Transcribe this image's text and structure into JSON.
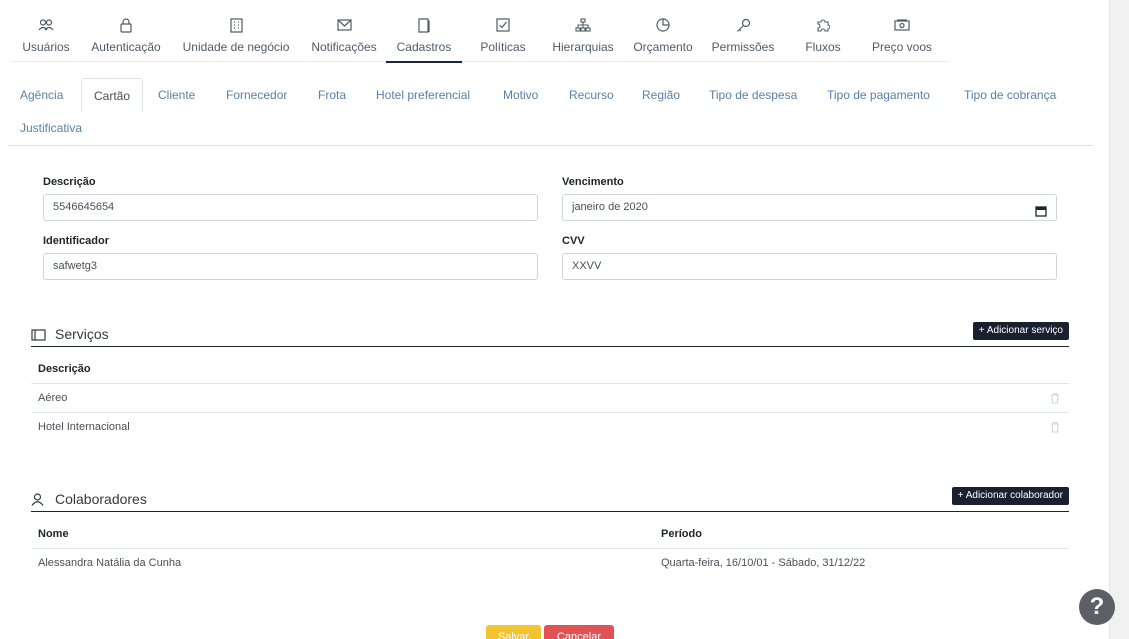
{
  "top_nav": {
    "items": [
      {
        "label": "Usuários",
        "icon": "users-icon"
      },
      {
        "label": "Autenticação",
        "icon": "lock-icon"
      },
      {
        "label": "Unidade de negócio",
        "icon": "building-icon"
      },
      {
        "label": "Notificações",
        "icon": "envelope-icon"
      },
      {
        "label": "Cadastros",
        "icon": "book-icon",
        "active": true
      },
      {
        "label": "Políticas",
        "icon": "checkbox-icon"
      },
      {
        "label": "Hierarquias",
        "icon": "sitemap-icon"
      },
      {
        "label": "Orçamento",
        "icon": "pie-chart-icon"
      },
      {
        "label": "Permissões",
        "icon": "key-icon"
      },
      {
        "label": "Fluxos",
        "icon": "puzzle-icon"
      },
      {
        "label": "Preço voos",
        "icon": "money-icon"
      }
    ]
  },
  "sub_tabs": {
    "items": [
      {
        "label": "Agência"
      },
      {
        "label": "Cartão",
        "active": true
      },
      {
        "label": "Cliente"
      },
      {
        "label": "Fornecedor"
      },
      {
        "label": "Frota"
      },
      {
        "label": "Hotel preferencial"
      },
      {
        "label": "Motivo"
      },
      {
        "label": "Recurso"
      },
      {
        "label": "Região"
      },
      {
        "label": "Tipo de despesa"
      },
      {
        "label": "Tipo de pagamento"
      },
      {
        "label": "Tipo de cobrança"
      },
      {
        "label": "Justificativa"
      }
    ]
  },
  "form": {
    "descricao_label": "Descrição",
    "descricao_value": "5546645654",
    "vencimento_label": "Vencimento",
    "vencimento_value": "janeiro de 2020",
    "identificador_label": "Identificador",
    "identificador_value": "safwetg3",
    "cvv_label": "CVV",
    "cvv_value": "XXVV"
  },
  "servicos": {
    "title": "Serviços",
    "add_button": "+ Adicionar serviço",
    "column_header": "Descrição",
    "rows": [
      {
        "descricao": "Aéreo"
      },
      {
        "descricao": "Hotel Internacional"
      }
    ]
  },
  "colaboradores": {
    "title": "Colaboradores",
    "add_button": "+ Adicionar colaborador",
    "columns": {
      "nome": "Nome",
      "periodo": "Período"
    },
    "rows": [
      {
        "nome": "Alessandra Natália da Cunha",
        "periodo": "Quarta-feira, 16/10/01 - Sábado, 31/12/22"
      }
    ]
  },
  "actions": {
    "save": "Salvar",
    "cancel": "Cancelar"
  },
  "help": {
    "label": "?"
  },
  "colors": {
    "primary_dark": "#1a2030",
    "save": "#f4c430",
    "cancel": "#e05253",
    "link": "#5a7fa8"
  }
}
